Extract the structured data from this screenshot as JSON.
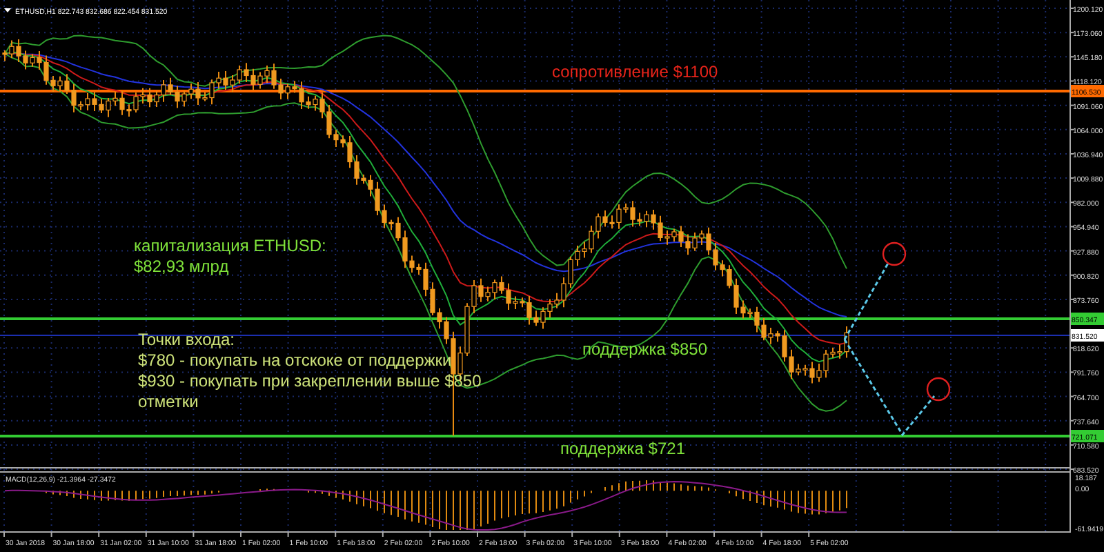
{
  "chart": {
    "header": "ETHUSD,H1  822.743 832.686 822.454 831.520",
    "price_ticks_upper": [
      "1200.120",
      "1173.060",
      "1145.180",
      "1118.120",
      "1091.060",
      "1064.000",
      "1036.940",
      "1009.880",
      "982.000",
      "954.940",
      "927.880",
      "900.820",
      "873.760"
    ],
    "price_ticks_lower": [
      "818.620",
      "791.760",
      "764.700",
      "737.640",
      "710.580",
      "683.520"
    ],
    "price_tags": [
      {
        "text": "1106.530",
        "kind": "resistance"
      },
      {
        "text": "850.347",
        "kind": "support"
      },
      {
        "text": "831.520",
        "kind": "current"
      },
      {
        "text": "721.071",
        "kind": "support"
      }
    ],
    "annotations": [
      {
        "kind": "resistance",
        "lines": [
          "сопротивление $1100"
        ]
      },
      {
        "kind": "info",
        "lines": [
          "капитализация ETHUSD:",
          "$82,93 млрд"
        ]
      },
      {
        "kind": "entry",
        "lines": [
          "Точки входа:",
          "$780 - покупать на отскоке от поддержки",
          "$930 - покупать при закреплении выше $850",
          "отметки"
        ]
      },
      {
        "kind": "support",
        "lines": [
          "поддержка $850"
        ]
      },
      {
        "kind": "support",
        "lines": [
          "поддержка $721"
        ]
      }
    ]
  },
  "macd": {
    "label": "MACD(12,26,9) -21.3964 -27.3472",
    "ticks": [
      "18.187",
      "0.00",
      "-61.9419"
    ]
  },
  "time_axis": [
    "30 Jan 2018",
    "30 Jan 18:00",
    "31 Jan 02:00",
    "31 Jan 10:00",
    "31 Jan 18:00",
    "1 Feb 02:00",
    "1 Feb 10:00",
    "1 Feb 18:00",
    "2 Feb 02:00",
    "2 Feb 10:00",
    "2 Feb 18:00",
    "3 Feb 02:00",
    "3 Feb 10:00",
    "3 Feb 18:00",
    "4 Feb 02:00",
    "4 Feb 10:00",
    "4 Feb 18:00",
    "5 Feb 02:00"
  ]
}
